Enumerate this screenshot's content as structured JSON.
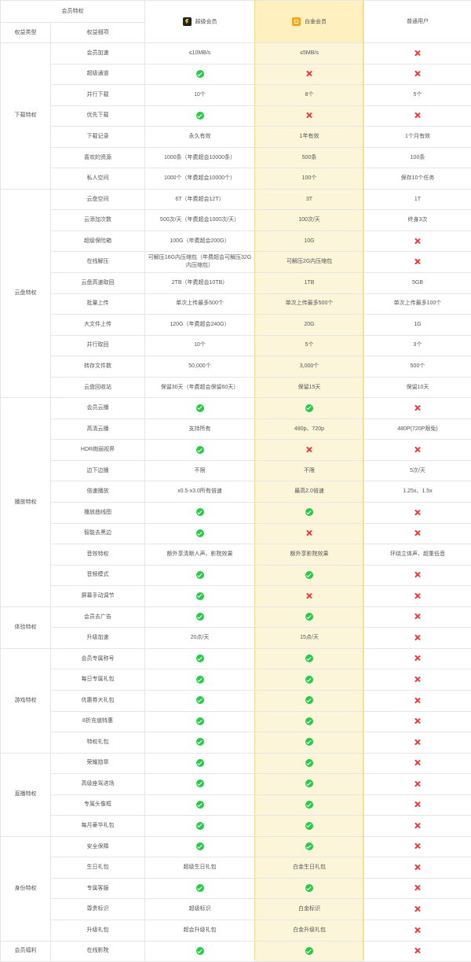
{
  "header": {
    "group_label": "会员特权",
    "type_label": "权益类型",
    "item_label": "权益细项",
    "tiers": [
      {
        "label": "超级会员",
        "icon": "lightning-badge-icon"
      },
      {
        "label": "白金会员",
        "icon": "platinum-badge-icon"
      },
      {
        "label": "普通用户"
      }
    ]
  },
  "colors": {
    "check": "#29c94a",
    "cross": "#f0393b",
    "platinum_bg": "#fdf5da",
    "platinum_header_bg": "#fff0bf"
  },
  "sections": [
    {
      "type": "下载特权",
      "rows": [
        {
          "item": "会员加速",
          "values": [
            "≤10MB/s",
            "≤5MB/s",
            "✗"
          ]
        },
        {
          "item": "超级通道",
          "values": [
            "✓",
            "✗",
            "✗"
          ]
        },
        {
          "item": "并行下载",
          "values": [
            "10个",
            "8个",
            "5个"
          ]
        },
        {
          "item": "优先下载",
          "values": [
            "✓",
            "✗",
            "✗"
          ]
        },
        {
          "item": "下载记录",
          "values": [
            "永久有效",
            "1年有效",
            "1个月有效"
          ]
        },
        {
          "item": "喜欢的资源",
          "values": [
            "1000条（年费超会10000条）",
            "500条",
            "100条"
          ]
        },
        {
          "item": "私人空间",
          "values": [
            "1000个（年费超会10000个）",
            "100个",
            "保存10个任务"
          ]
        }
      ]
    },
    {
      "type": "云盘特权",
      "rows": [
        {
          "item": "云盘空间",
          "values": [
            "6T（年费超会12T）",
            "3T",
            "1T"
          ]
        },
        {
          "item": "云添加次数",
          "values": [
            "500次/天（年费超会1000次/天）",
            "100次/天",
            "终身3次"
          ]
        },
        {
          "item": "超级保险箱",
          "values": [
            "100G（年费超会200G）",
            "10G",
            "✗"
          ]
        },
        {
          "item": "在线解压",
          "values": [
            "可解压16G内压缩包（年费超会可解压32G内压缩包）",
            "可解压2G内压缩包",
            "✗"
          ]
        },
        {
          "item": "云盘高速取回",
          "values": [
            "2TB（年费超会10TB）",
            "1TB",
            "5GB"
          ]
        },
        {
          "item": "批量上传",
          "values": [
            "单次上传最多500个",
            "单次上传最多500个",
            "单次上传最多100个"
          ]
        },
        {
          "item": "大文件上传",
          "values": [
            "120G（年费超会240G）",
            "20G",
            "1G"
          ]
        },
        {
          "item": "并行取回",
          "values": [
            "10个",
            "5个",
            "3个"
          ]
        },
        {
          "item": "转存文件数",
          "values": [
            "50,000个",
            "3,000个",
            "500个"
          ]
        },
        {
          "item": "云盘回收站",
          "values": [
            "保留30天（年费超会保留60天）",
            "保留15天",
            "保留10天"
          ]
        }
      ]
    },
    {
      "type": "播放特权",
      "rows": [
        {
          "item": "会员云播",
          "values": [
            "✓",
            "✓",
            "✗"
          ]
        },
        {
          "item": "高清云播",
          "values": [
            "支持所有",
            "480p、720p",
            "480P(720P限免)"
          ]
        },
        {
          "item": "HDR绚丽视界",
          "values": [
            "✓",
            "✗",
            "✗"
          ]
        },
        {
          "item": "边下边播",
          "values": [
            "不限",
            "不限",
            "5次/天"
          ]
        },
        {
          "item": "倍速播放",
          "values": [
            "x0.5-x3.0所有倍速",
            "最高2.0倍速",
            "1.25x、1.5x"
          ]
        },
        {
          "item": "播放曲线图",
          "values": [
            "✓",
            "✓",
            "✗"
          ]
        },
        {
          "item": "智能去黑边",
          "values": [
            "✓",
            "✗",
            "✗"
          ]
        },
        {
          "item": "音效特权",
          "values": [
            "额外享清晰人声、影院效果",
            "额外享影院效果",
            "环绕立体声、超重低音"
          ]
        },
        {
          "item": "音频模式",
          "values": [
            "✓",
            "✓",
            "✗"
          ]
        },
        {
          "item": "屏幕手动调节",
          "values": [
            "✓",
            "✗",
            "✗"
          ]
        }
      ]
    },
    {
      "type": "体验特权",
      "rows": [
        {
          "item": "会员去广告",
          "values": [
            "✓",
            "✓",
            "✗"
          ]
        },
        {
          "item": "升级加速",
          "values": [
            "20点/天",
            "15点/天",
            "✗"
          ]
        }
      ]
    },
    {
      "type": "游戏特权",
      "rows": [
        {
          "item": "会员专属称号",
          "values": [
            "✓",
            "✓",
            "✗"
          ]
        },
        {
          "item": "每日专属礼包",
          "values": [
            "✓",
            "✓",
            "✗"
          ]
        },
        {
          "item": "优惠券大礼包",
          "values": [
            "✓",
            "✓",
            "✗"
          ]
        },
        {
          "item": "8折充值特惠",
          "values": [
            "✓",
            "✓",
            "✗"
          ]
        },
        {
          "item": "特权礼包",
          "values": [
            "✓",
            "✓",
            "✗"
          ]
        }
      ]
    },
    {
      "type": "直播特权",
      "rows": [
        {
          "item": "荣耀勋章",
          "values": [
            "✓",
            "✓",
            "✗"
          ]
        },
        {
          "item": "高级座驾进场",
          "values": [
            "✓",
            "✓",
            "✗"
          ]
        },
        {
          "item": "专属头像框",
          "values": [
            "✓",
            "✓",
            "✗"
          ]
        },
        {
          "item": "每月豪华礼包",
          "values": [
            "✓",
            "✓",
            "✗"
          ]
        }
      ]
    },
    {
      "type": "身份特权",
      "rows": [
        {
          "item": "安全保障",
          "values": [
            "✓",
            "✓",
            "✗"
          ]
        },
        {
          "item": "生日礼包",
          "values": [
            "超级生日礼包",
            "白金生日礼包",
            "✗"
          ]
        },
        {
          "item": "专属客服",
          "values": [
            "✓",
            "✓",
            "✗"
          ]
        },
        {
          "item": "尊贵标识",
          "values": [
            "超级标识",
            "白金标识",
            "✗"
          ]
        },
        {
          "item": "升级礼包",
          "values": [
            "超会升级礼包",
            "白金升级礼包",
            "✗"
          ]
        }
      ]
    },
    {
      "type": "会员福利",
      "rows": [
        {
          "item": "在线影院",
          "values": [
            "✓",
            "✓",
            "✗"
          ]
        }
      ]
    }
  ]
}
